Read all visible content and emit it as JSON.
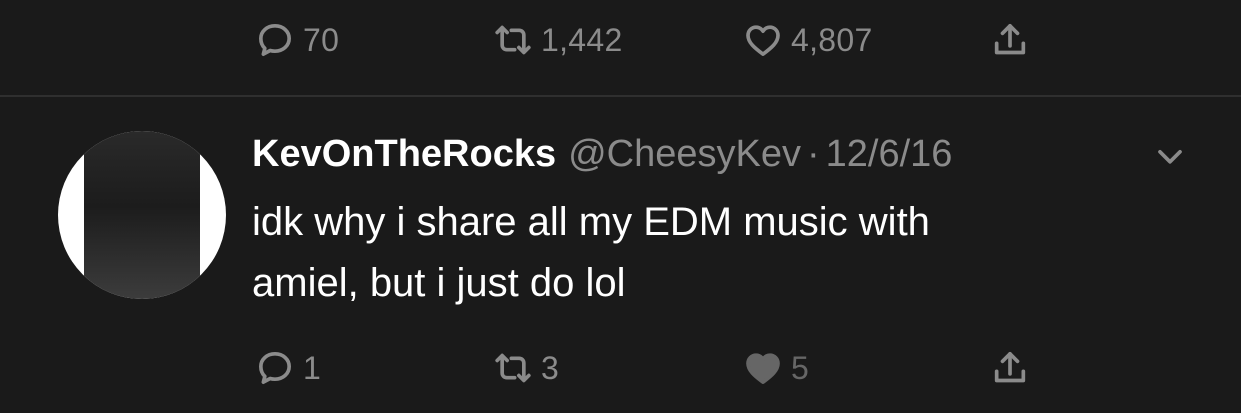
{
  "previous_tweet": {
    "actions": {
      "reply_count": "70",
      "retweet_count": "1,442",
      "like_count": "4,807"
    }
  },
  "tweet": {
    "display_name": "KevOnTheRocks",
    "handle": "@CheesyKev",
    "separator": "·",
    "date": "12/6/16",
    "text_lines": [
      "idk why i share all my EDM music with",
      "amiel, but i just do lol"
    ],
    "actions": {
      "reply_count": "1",
      "retweet_count": "3",
      "like_count": "5",
      "liked": true
    }
  },
  "icons": [
    "reply-icon",
    "retweet-icon",
    "like-icon",
    "share-icon",
    "chevron-down-icon"
  ],
  "colors": {
    "background": "#1a1a1a",
    "primary_text": "#ffffff",
    "secondary_text": "#8b8b8b",
    "divider": "#2f2f2f",
    "liked_heart": "#666666"
  }
}
